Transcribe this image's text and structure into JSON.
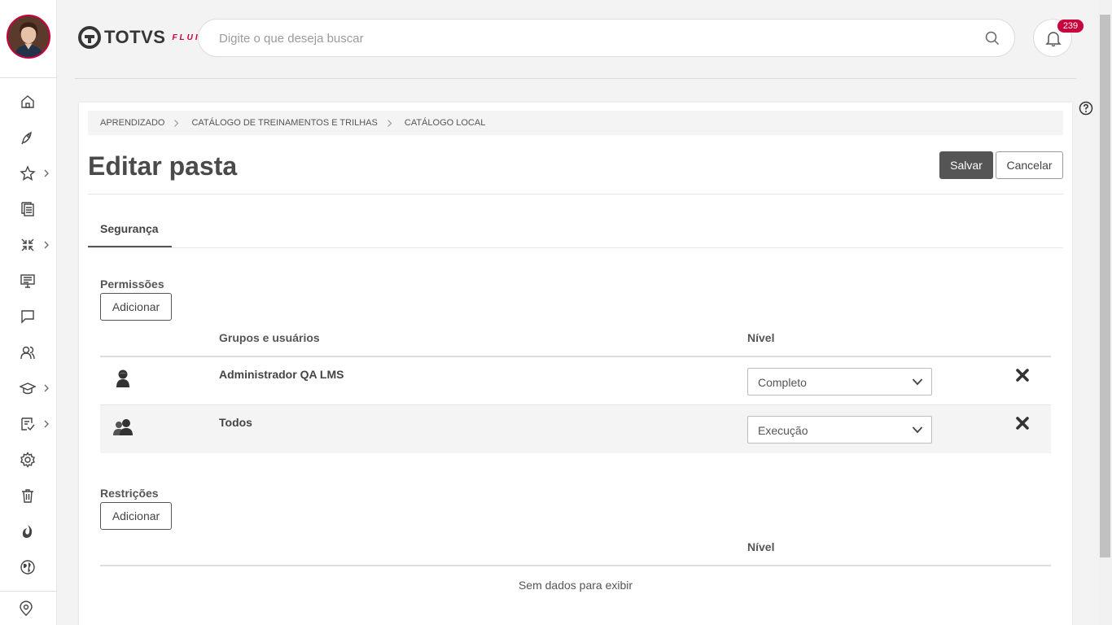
{
  "search": {
    "placeholder": "Digite o que deseja buscar"
  },
  "header": {
    "logo_text": "TOTVS",
    "logo_sub": "FLUIG",
    "notifications_count": "239"
  },
  "breadcrumb": [
    "APRENDIZADO",
    "CATÁLOGO DE TREINAMENTOS E TRILHAS",
    "CATÁLOGO LOCAL"
  ],
  "page": {
    "title": "Editar pasta",
    "save_label": "Salvar",
    "cancel_label": "Cancelar"
  },
  "tabs": [
    {
      "label": "Segurança",
      "active": true
    }
  ],
  "permissions": {
    "title": "Permissões",
    "add_label": "Adicionar",
    "col_groups": "Grupos e usuários",
    "col_level": "Nível",
    "rows": [
      {
        "name": "Administrador QA LMS",
        "level": "Completo",
        "icon": "user-icon"
      },
      {
        "name": "Todos",
        "level": "Execução",
        "icon": "group-icon"
      }
    ]
  },
  "restrictions": {
    "title": "Restrições",
    "add_label": "Adicionar",
    "col_level": "Nível",
    "empty": "Sem dados para exibir"
  },
  "colors": {
    "brand": "#c8003c",
    "primary_button": "#555555"
  }
}
